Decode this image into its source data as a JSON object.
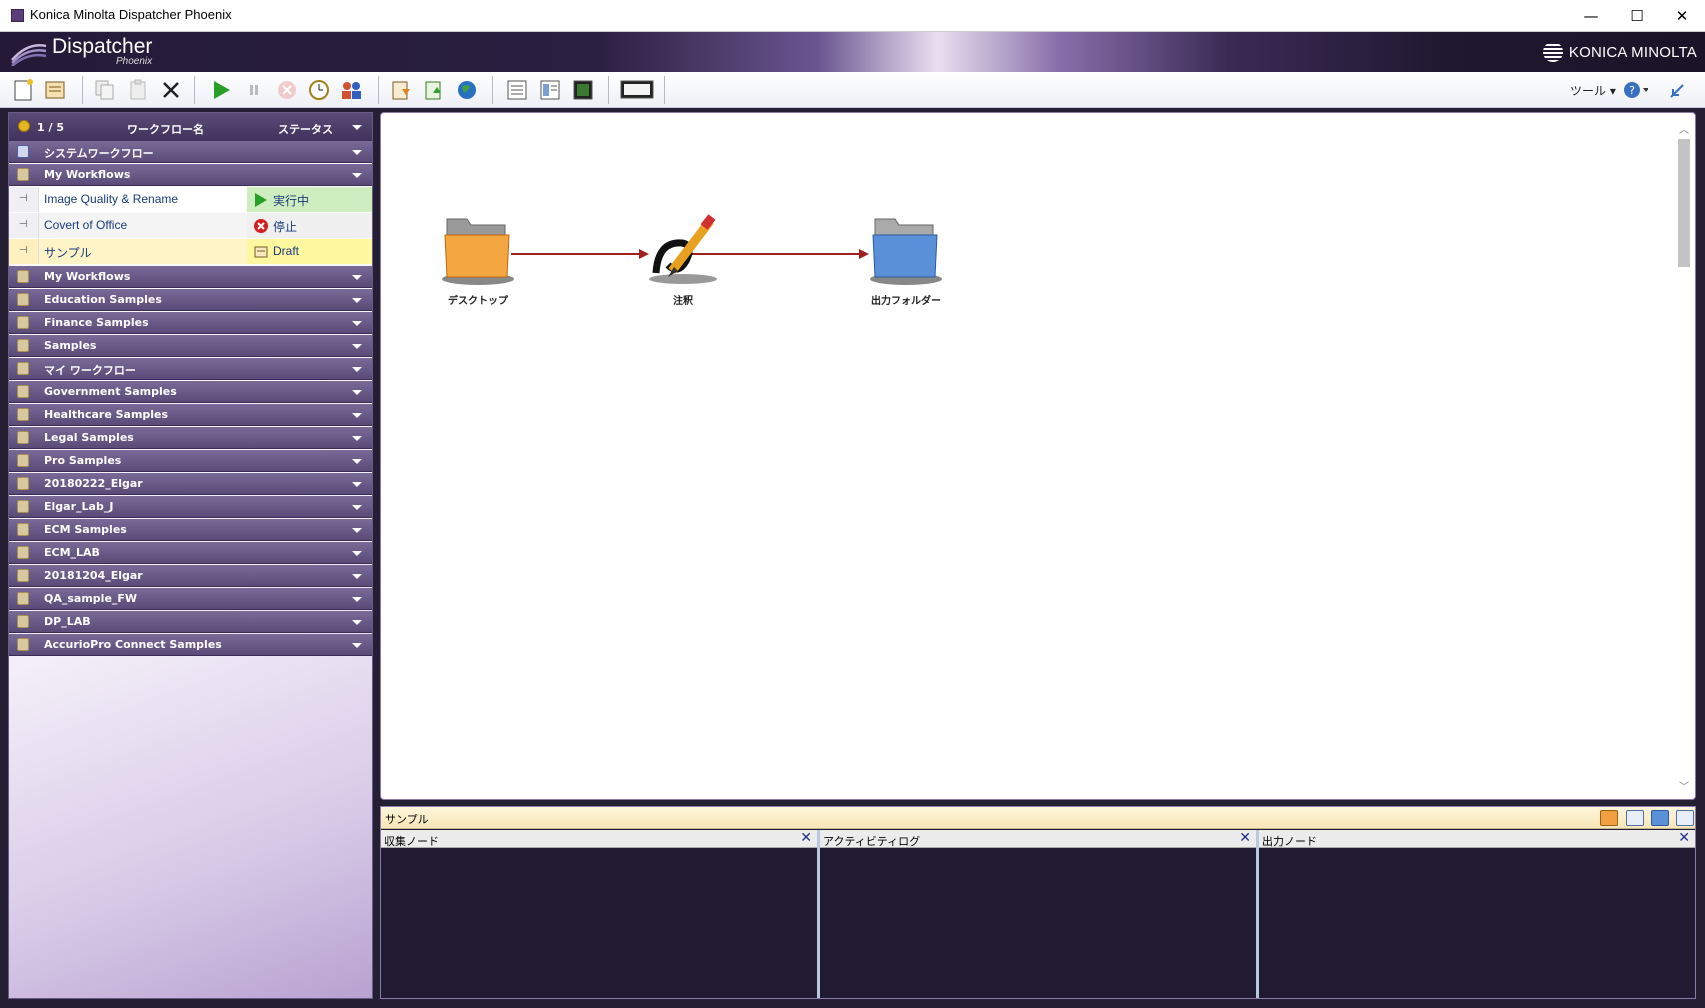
{
  "window": {
    "title": "Konica Minolta Dispatcher Phoenix",
    "controls": {
      "minimize": "—",
      "maximize": "☐",
      "close": "✕"
    }
  },
  "banner": {
    "brand": "Dispatcher",
    "brand_sub": "Phoenix",
    "company": "KONICA MINOLTA"
  },
  "toolbar": {
    "tools_menu": "ツール ▾",
    "help_menu": "? ▾"
  },
  "workflow_list": {
    "count": "1 / 5",
    "col_name": "ワークフロー名",
    "col_status": "ステータス",
    "groups_top": [
      {
        "label": "システムワークフロー",
        "icon": "system-icon"
      },
      {
        "label": "My Workflows",
        "icon": "folder-icon"
      }
    ],
    "rows": [
      {
        "name": "Image Quality & Rename",
        "status": "実行中",
        "state": "running"
      },
      {
        "name": "Covert of Office",
        "status": "停止",
        "state": "stopped"
      },
      {
        "name": "サンプル",
        "status": "Draft",
        "state": "draft"
      }
    ],
    "groups": [
      "My Workflows",
      "Education Samples",
      "Finance Samples",
      "Samples",
      "マイ ワークフロー",
      "Government Samples",
      "Healthcare Samples",
      "Legal Samples",
      "Pro Samples",
      "20180222_Elgar",
      "Elgar_Lab_J",
      "ECM Samples",
      "ECM_LAB",
      "20181204_Elgar",
      "QA_sample_FW",
      "DP_LAB",
      "AccurioPro Connect Samples"
    ]
  },
  "canvas": {
    "nodes": [
      {
        "label": "デスクトップ",
        "icon": "orange-folder-icon"
      },
      {
        "label": "注釈",
        "icon": "annotation-pencil-icon"
      },
      {
        "label": "出力フォルダー",
        "icon": "blue-folder-icon"
      }
    ]
  },
  "bottom_panel": {
    "title": "サンプル",
    "panes": [
      {
        "title": "収集ノード",
        "close": "✕"
      },
      {
        "title": "アクティビティログ",
        "close": "✕"
      },
      {
        "title": "出力ノード",
        "close": "✕"
      }
    ]
  }
}
